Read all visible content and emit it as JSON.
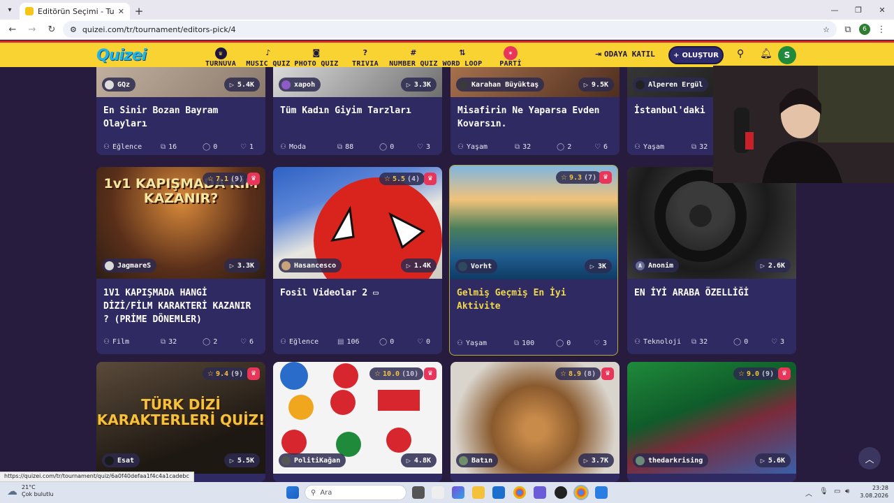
{
  "browser": {
    "tab_title": "Editörün Seçimi - Turnuva - Qu",
    "url": "quizei.com/tr/tournament/editors-pick/4",
    "profile_initial": "6",
    "status_url": "https://quizei.com/tr/tournament/quiz/6a0f40defaa1f4c4a1cadebc"
  },
  "header": {
    "logo": "Quizei",
    "nav": [
      "TURNUVA",
      "MUSIC QUIZ",
      "PHOTO QUIZ",
      "TRIVIA",
      "NUMBER QUIZ",
      "WORD LOOP",
      "PARTİ"
    ],
    "join_label": "ODAYA KATIL",
    "create_label": "OLUŞTUR",
    "avatar_initial": "S"
  },
  "cards": [
    {
      "author": "GQz",
      "views": "5.4K",
      "title": "En Sinir Bozan Bayram Olayları",
      "category": "Eğlence",
      "questions": "16",
      "comments": "0",
      "likes": "1"
    },
    {
      "author": "xapoh",
      "views": "3.3K",
      "title": "Tüm Kadın Giyim Tarzları",
      "category": "Moda",
      "questions": "88",
      "comments": "0",
      "likes": "3"
    },
    {
      "author": "Karahan Büyüktaş",
      "views": "9.5K",
      "title": "Misafirin Ne Yaparsa Evden Kovarsın.",
      "category": "Yaşam",
      "questions": "32",
      "comments": "2",
      "likes": "6"
    },
    {
      "author": "Alperen Ergül",
      "views": "",
      "title": "İstanbul'daki",
      "category": "Yaşam",
      "questions": "32",
      "comments": "",
      "likes": ""
    },
    {
      "author": "JagmareS",
      "views": "3.3K",
      "rating": "7.1",
      "rating_count": "(9)",
      "title": "1V1 KAPIŞMADA HANGİ DİZİ/FİLM KARAKTERİ KAZANIR ? (PRİME DÖNEMLER)",
      "thumb_text": "1v1 KAPIŞMADA KİM KAZANIR?",
      "category": "Film",
      "questions": "32",
      "comments": "2",
      "likes": "6"
    },
    {
      "author": "Hasancesco",
      "views": "1.4K",
      "rating": "5.5",
      "rating_count": "(4)",
      "title": "Fosil Videolar 2 ▭",
      "category": "Eğlence",
      "questions": "106",
      "comments": "0",
      "likes": "0"
    },
    {
      "author": "Vorht",
      "views": "3K",
      "rating": "9.3",
      "rating_count": "(7)",
      "title": "Gelmiş Geçmiş En İyi Aktivite",
      "category": "Yaşam",
      "questions": "100",
      "comments": "0",
      "likes": "3"
    },
    {
      "author": "Anonim",
      "views": "2.6K",
      "title": "EN İYİ ARABA ÖZELLİĞİ",
      "category": "Teknoloji",
      "questions": "32",
      "comments": "0",
      "likes": "3"
    },
    {
      "author": "Esat",
      "views": "5.5K",
      "rating": "9.4",
      "rating_count": "(9)",
      "thumb_text": "TÜRK DİZİ KARAKTERLERİ QUİZ!"
    },
    {
      "author": "PolitiKağan",
      "views": "4.8K",
      "rating": "10.0",
      "rating_count": "(10)"
    },
    {
      "author": "Batın",
      "views": "3.7K",
      "rating": "8.9",
      "rating_count": "(8)"
    },
    {
      "author": "thedarkrising",
      "views": "5.6K",
      "rating": "9.0",
      "rating_count": "(9)"
    }
  ],
  "taskbar": {
    "temp": "21°C",
    "weather": "Çok bulutlu",
    "search_placeholder": "Ara",
    "time": "23:28",
    "date": "3.08.2026"
  }
}
